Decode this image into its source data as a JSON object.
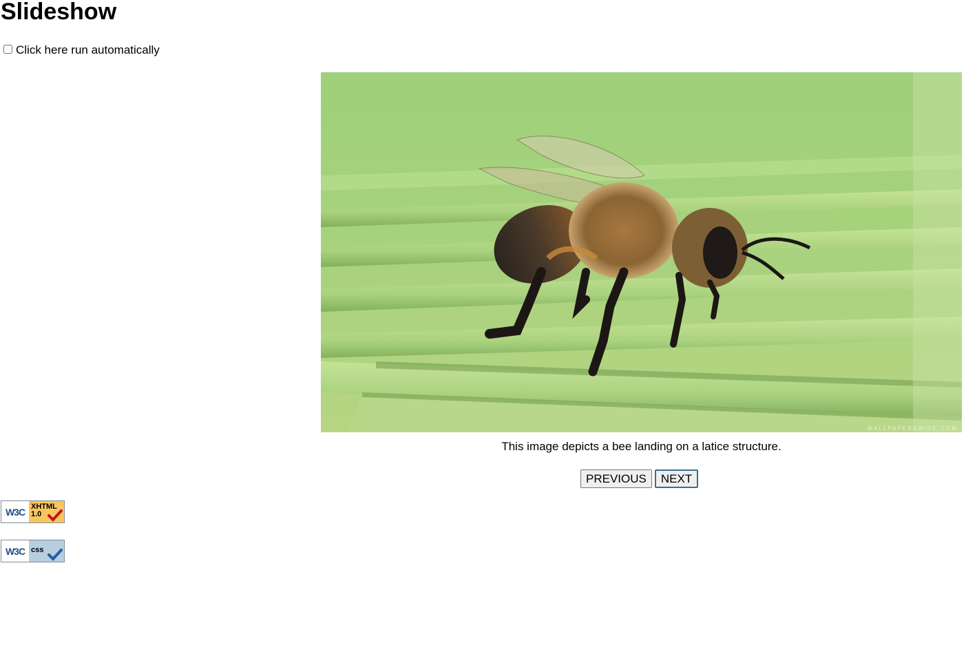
{
  "page": {
    "title": "Slideshow",
    "auto_run_label": "Click here run automatically",
    "auto_run_checked": false
  },
  "slide": {
    "image_icon": "bee-photo",
    "caption": "This image depicts a bee landing on a latice structure.",
    "watermark": "WALLPAPERSWIDE.COM"
  },
  "controls": {
    "previous_label": "PREVIOUS",
    "next_label": "NEXT"
  },
  "badges": [
    {
      "left": "W3C",
      "right_line1": "XHTML",
      "right_line2": "1.0",
      "check_color": "#c0161b"
    },
    {
      "left": "W3C",
      "right_line1": "css",
      "right_line2": "",
      "check_color": "#1f5fa6"
    }
  ]
}
